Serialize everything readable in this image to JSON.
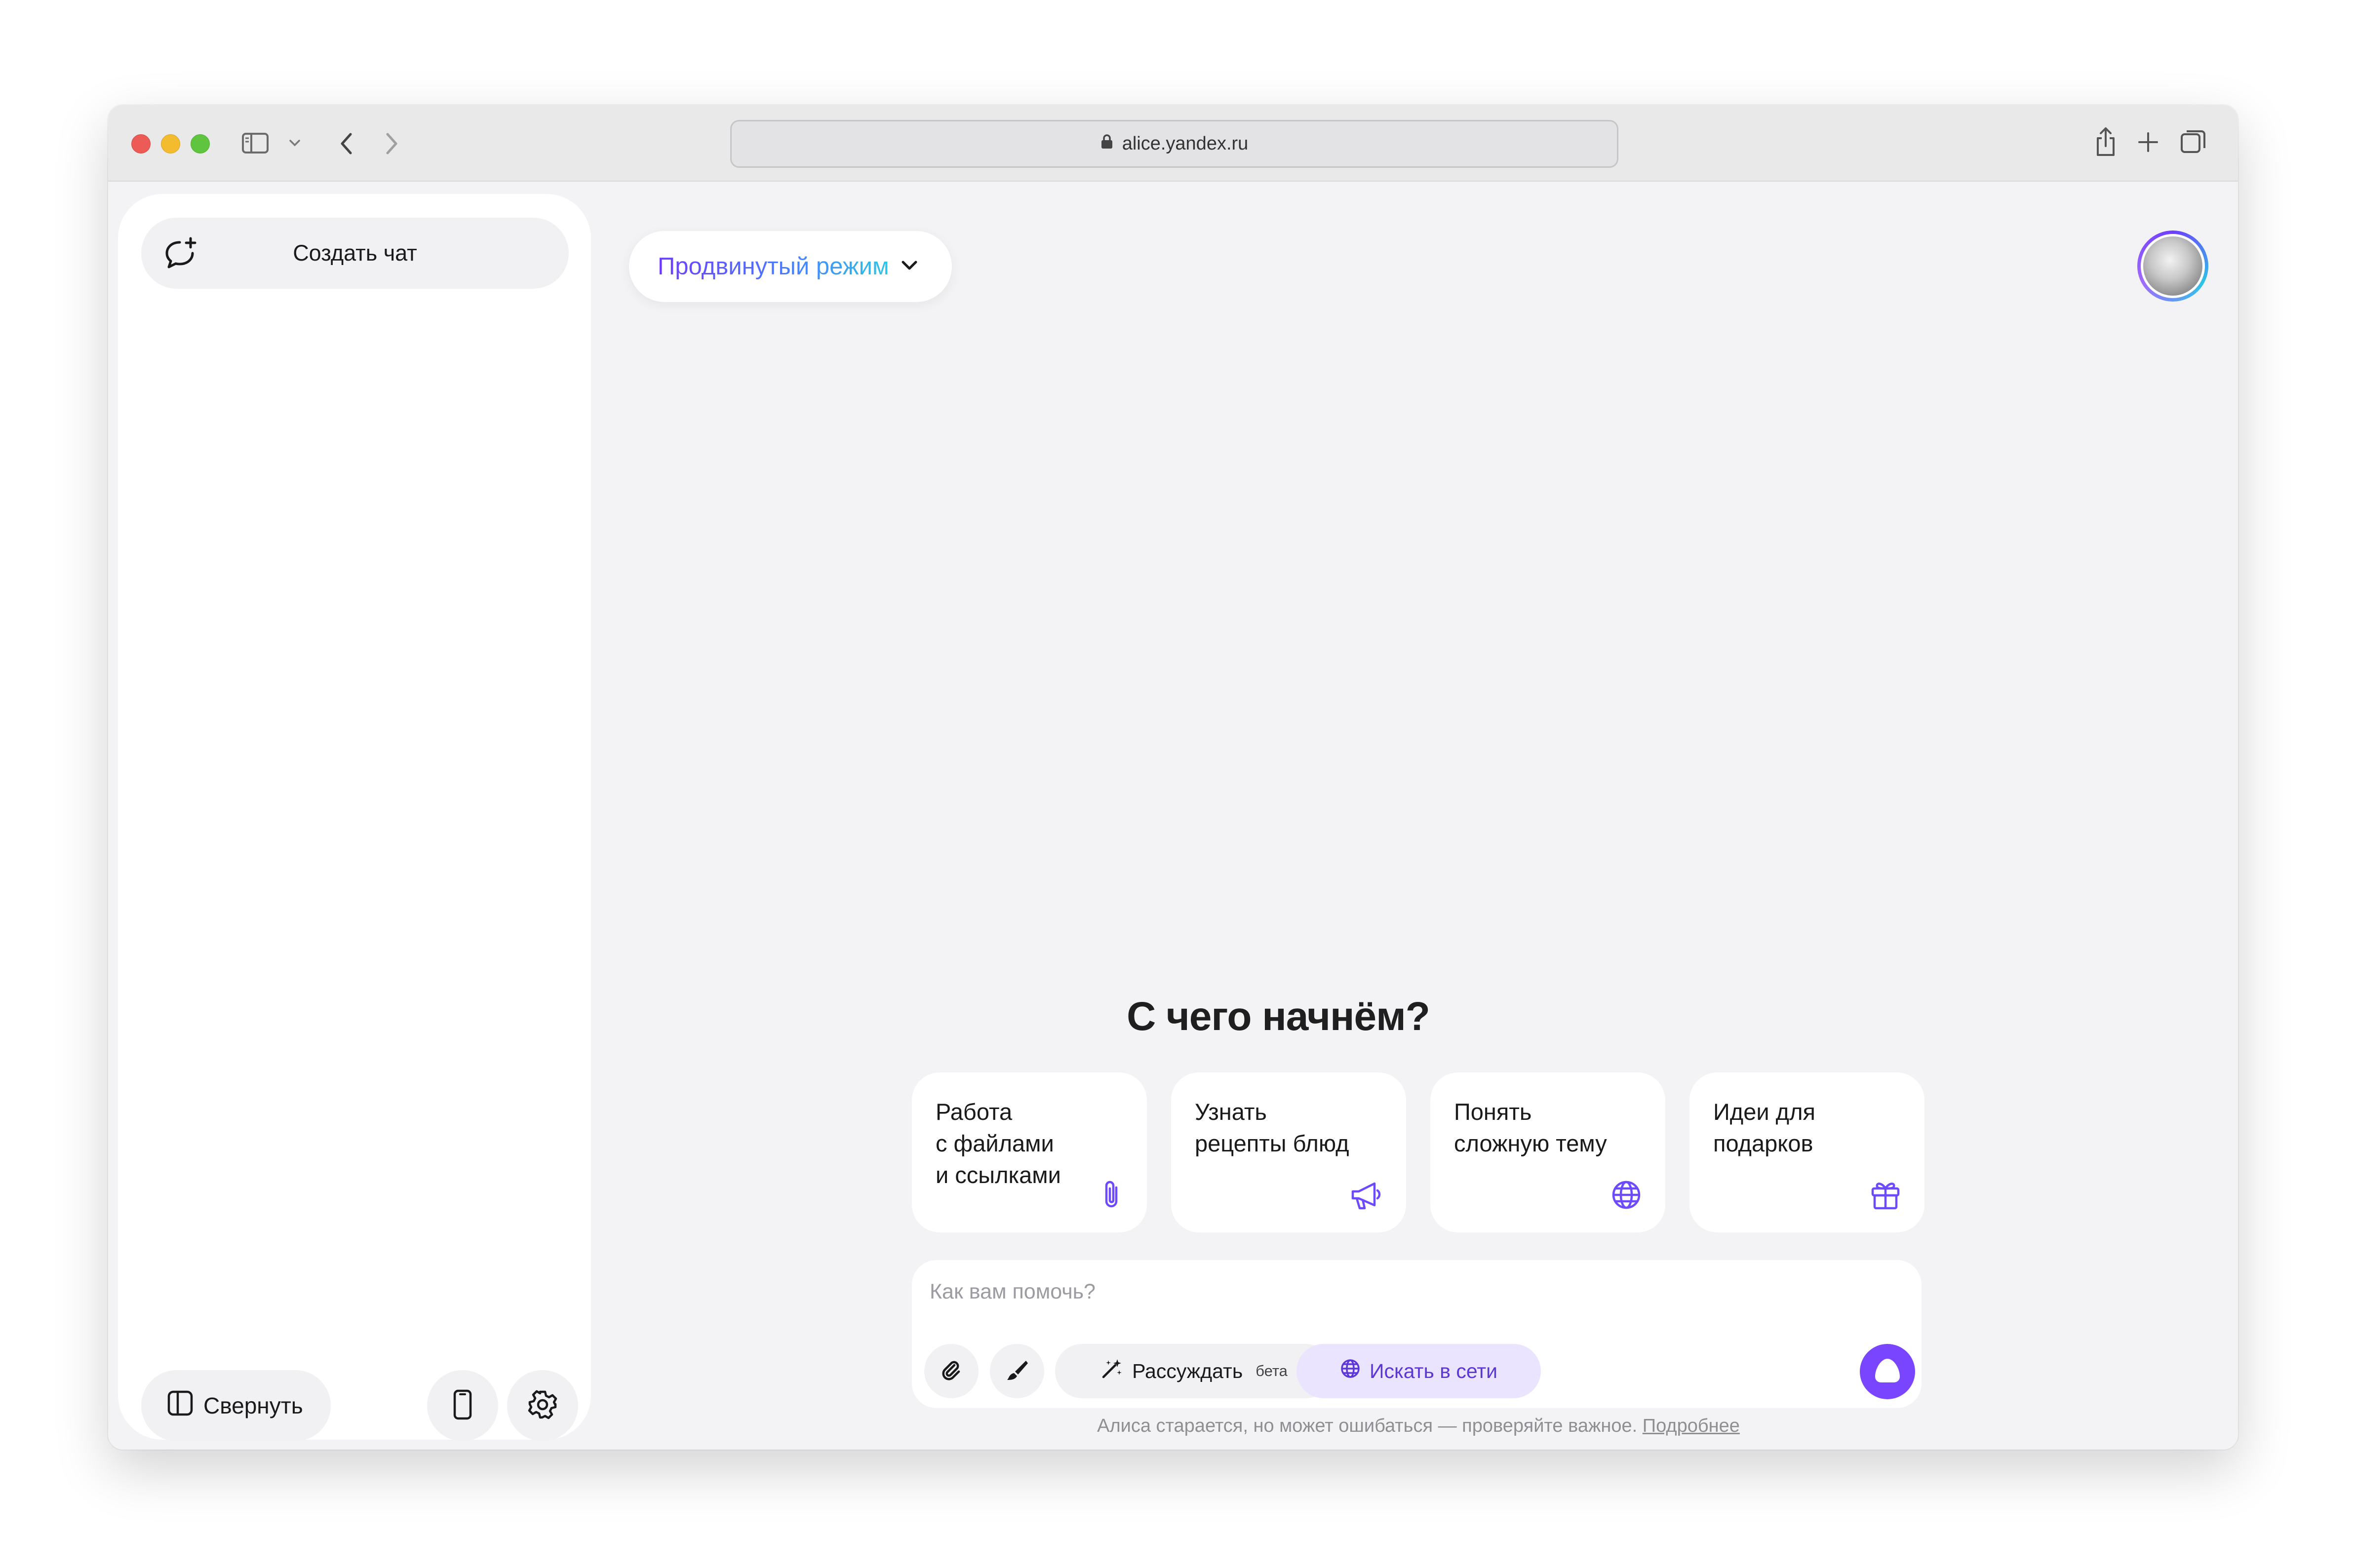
{
  "browser": {
    "url": "alice.yandex.ru",
    "traffic_lights": [
      "close",
      "minimize",
      "maximize"
    ],
    "toolbar_icons": [
      "sidebar-toggle-icon",
      "chevron-down-icon",
      "back-icon",
      "forward-icon",
      "share-icon",
      "new-tab-icon",
      "tabs-overview-icon"
    ]
  },
  "sidebar": {
    "new_chat_label": "Создать чат",
    "collapse_label": "Свернуть",
    "icons": [
      "new-chat-icon",
      "sidebar-collapse-icon",
      "mobile-phone-icon",
      "gear-icon"
    ]
  },
  "header": {
    "mode_label": "Продвинутый режим",
    "mode_gradient": [
      "#6f3dff",
      "#4a7cff",
      "#2ec4e6"
    ]
  },
  "main": {
    "headline": "С чего начнём?",
    "cards": [
      {
        "text": "Работа\nс файлами\nи ссылками",
        "icon": "paperclip-icon"
      },
      {
        "text": "Узнать\nрецепты блюд",
        "icon": "megaphone-icon"
      },
      {
        "text": "Понять\nсложную тему",
        "icon": "globe-icon"
      },
      {
        "text": "Идеи для\nподарков",
        "icon": "gift-icon"
      }
    ]
  },
  "composer": {
    "placeholder": "Как вам помочь?",
    "value": "",
    "reason_label": "Рассуждать",
    "beta_label": "бета",
    "search_label": "Искать в сети",
    "icons": [
      "attach-icon",
      "brush-icon",
      "sparkle-icon",
      "globe-icon",
      "alice-send-icon"
    ]
  },
  "footer": {
    "disclaimer": "Алиса старается, но может ошибаться — проверяйте важное.",
    "more_link": "Подробнее"
  },
  "colors": {
    "accent": "#7a45ff",
    "icon_purple": "#6e4aff",
    "search_pill_bg": "#ebe4ff",
    "page_bg": "#f3f3f5"
  }
}
